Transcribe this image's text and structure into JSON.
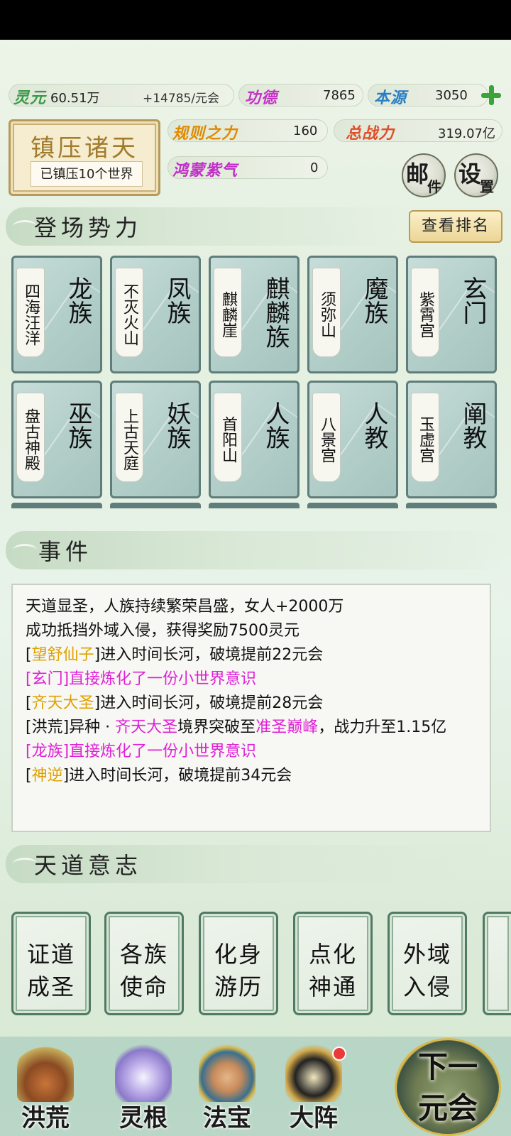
{
  "resources": {
    "lingyuan": {
      "label": "灵元",
      "value": "60.51万",
      "rate": "+14785/元会"
    },
    "gongde": {
      "label": "功德",
      "value": "7865"
    },
    "benyuan": {
      "label": "本源",
      "value": "3050"
    },
    "guize": {
      "label": "规则之力",
      "value": "160"
    },
    "zongzhanli": {
      "label": "总战力",
      "value": "319.07亿"
    },
    "hongmeng": {
      "label": "鸿蒙紫气",
      "value": "0"
    }
  },
  "plaque": {
    "title": "镇压诸天",
    "subtitle": "已镇压10个世界"
  },
  "buttons": {
    "mail": {
      "big": "邮",
      "small": "件"
    },
    "settings": {
      "big": "设",
      "small": "置"
    },
    "rank": "查看排名"
  },
  "sections": {
    "factions": "登场势力",
    "events": "事件",
    "will": "天道意志"
  },
  "factions": [
    {
      "place": "四海汪洋",
      "name": "龙族"
    },
    {
      "place": "不灭火山",
      "name": "凤族"
    },
    {
      "place": "麒麟崖",
      "name": "麒麟族"
    },
    {
      "place": "须弥山",
      "name": "魔族"
    },
    {
      "place": "紫霄宫",
      "name": "玄门"
    },
    {
      "place": "盘古神殿",
      "name": "巫族"
    },
    {
      "place": "上古天庭",
      "name": "妖族"
    },
    {
      "place": "首阳山",
      "name": "人族"
    },
    {
      "place": "八景宫",
      "name": "人教"
    },
    {
      "place": "玉虚宫",
      "name": "阐教"
    }
  ],
  "events": {
    "line1": "天道显圣，人族持续繁荣昌盛，女人+2000万",
    "line2": "成功抵挡外域入侵，获得奖励7500灵元",
    "line3": {
      "name": "望舒仙子",
      "rest": "进入时间长河，破境提前22元会"
    },
    "line4": "[玄门]直接炼化了一份小世界意识",
    "line5": {
      "name": "齐天大圣",
      "rest": "进入时间长河，破境提前28元会"
    },
    "line6": {
      "prefix": "[洪荒]异种 · ",
      "name": "齐天大圣",
      "mid": "境界突破至",
      "realm": "准圣巅峰",
      "rest": "，战力升至1.15亿"
    },
    "line7": "[龙族]直接炼化了一份小世界意识",
    "line8": {
      "name": "神逆",
      "rest": "进入时间长河，破境提前34元会"
    }
  },
  "will_cards": [
    {
      "l1": "证道",
      "l2": "成圣"
    },
    {
      "l1": "各族",
      "l2": "使命"
    },
    {
      "l1": "化身",
      "l2": "游历"
    },
    {
      "l1": "点化",
      "l2": "神通"
    },
    {
      "l1": "外域",
      "l2": "入侵"
    }
  ],
  "nav": [
    "洪荒",
    "灵根",
    "法宝",
    "大阵"
  ],
  "next": {
    "l1": "下一",
    "l2": "元会"
  },
  "colors": {
    "orange": "#e0a000",
    "pink": "#e020d8",
    "green_plus": "#3aa43a"
  }
}
